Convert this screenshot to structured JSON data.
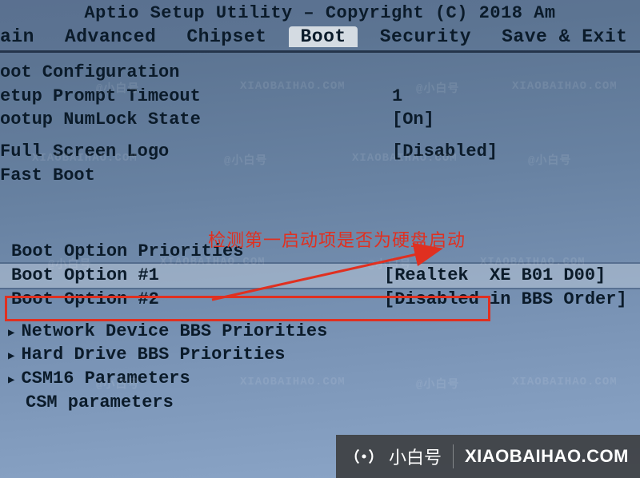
{
  "title": "Aptio Setup Utility – Copyright (C) 2018 Am",
  "tabs": {
    "main": "ain",
    "advanced": "Advanced",
    "chipset": "Chipset",
    "boot": "Boot",
    "security": "Security",
    "save_exit": "Save & Exit"
  },
  "section": {
    "boot_configuration": "oot Configuration",
    "setup_prompt_timeout": {
      "label": "etup Prompt Timeout",
      "value": "1"
    },
    "bootup_numlock_state": {
      "label": "ootup NumLock State",
      "value": "[On]"
    },
    "full_screen_logo": {
      "label": "Full Screen Logo",
      "value": "[Disabled]"
    },
    "fast_boot": {
      "label": "Fast Boot",
      "value": ""
    },
    "boot_option_priorities": "Boot Option Priorities",
    "boot_option_1": {
      "label": "Boot Option #1",
      "value": "[Realtek  XE B01 D00]"
    },
    "boot_option_2": {
      "label": "Boot Option #2",
      "value": "[Disabled in BBS Order]"
    },
    "network_bbs": "Network Device BBS Priorities",
    "hard_drive_bbs": "Hard Drive BBS Priorities",
    "csm16_parameters": "CSM16 Parameters",
    "csm_parameters": "CSM parameters"
  },
  "annotation": {
    "callout_text": "检测第一启动项是否为硬盘启动"
  },
  "watermark": {
    "text_cn": "@小白号",
    "text_en": "XIAOBAIHAO.COM"
  },
  "brand": {
    "name": "小白号",
    "domain": "XIAOBAIHAO.COM"
  }
}
